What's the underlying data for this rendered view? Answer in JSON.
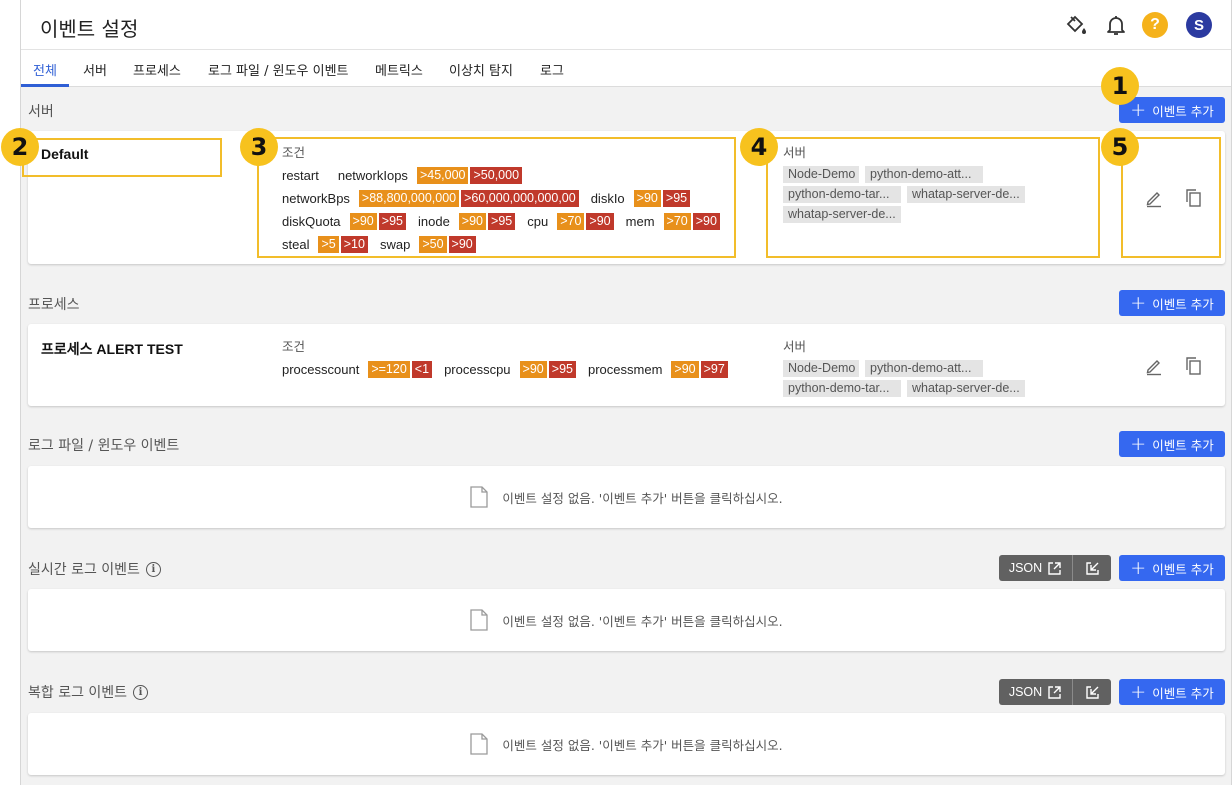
{
  "header": {
    "title": "이벤트 설정",
    "help_label": "?",
    "avatar_initial": "S"
  },
  "tabs": [
    "전체",
    "서버",
    "프로세스",
    "로그 파일 / 윈도우 이벤트",
    "메트릭스",
    "이상치 탐지",
    "로그"
  ],
  "add_button_label": "이벤트 추가",
  "json_label": "JSON",
  "empty_message": "이벤트 설정 없음. '이벤트 추가' 버튼을 클릭하십시오.",
  "sections": {
    "server": {
      "title": "서버",
      "rule_name": "Default",
      "condition_label": "조건",
      "server_label": "서버",
      "conditions": {
        "restart": "restart",
        "networkIops": {
          "name": "networkIops",
          "warn": ">45,000",
          "crit": ">50,000"
        },
        "networkBps": {
          "name": "networkBps",
          "warn": ">88,800,000,000",
          "crit": ">60,000,000,000,00"
        },
        "diskIo": {
          "name": "diskIo",
          "warn": ">90",
          "crit": ">95"
        },
        "diskQuota": {
          "name": "diskQuota",
          "warn": ">90",
          "crit": ">95"
        },
        "inode": {
          "name": "inode",
          "warn": ">90",
          "crit": ">95"
        },
        "cpu": {
          "name": "cpu",
          "warn": ">70",
          "crit": ">90"
        },
        "mem": {
          "name": "mem",
          "warn": ">70",
          "crit": ">90"
        },
        "steal": {
          "name": "steal",
          "warn": ">5",
          "crit": ">10"
        },
        "swap": {
          "name": "swap",
          "warn": ">50",
          "crit": ">90"
        }
      },
      "servers": [
        "Node-Demo",
        "python-demo-att...",
        "python-demo-tar...",
        "whatap-server-de...",
        "whatap-server-de..."
      ]
    },
    "process": {
      "title": "프로세스",
      "rule_name": "프로세스 ALERT TEST",
      "condition_label": "조건",
      "server_label": "서버",
      "conditions": {
        "processcount": {
          "name": "processcount",
          "warn": ">=120",
          "crit": "<1"
        },
        "processcpu": {
          "name": "processcpu",
          "warn": ">90",
          "crit": ">95"
        },
        "processmem": {
          "name": "processmem",
          "warn": ">90",
          "crit": ">97"
        }
      },
      "servers": [
        "Node-Demo",
        "python-demo-att...",
        "python-demo-tar...",
        "whatap-server-de..."
      ]
    },
    "logfile": {
      "title": "로그 파일 / 윈도우 이벤트"
    },
    "realtime": {
      "title": "실시간 로그 이벤트"
    },
    "composite": {
      "title": "복합 로그 이벤트"
    }
  },
  "annotations": [
    "1",
    "2",
    "3",
    "4",
    "5"
  ],
  "colors": {
    "primary": "#3568f0",
    "warn": "#e8901b",
    "crit": "#c0392b",
    "highlight": "#f2bd2a",
    "active_tab": "#2f5fd5"
  }
}
